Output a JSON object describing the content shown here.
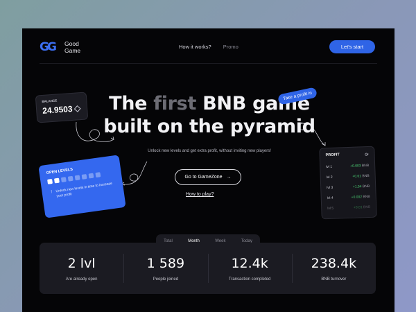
{
  "brand": {
    "line1": "Good",
    "line2": "Game",
    "mark": "GG",
    "accent": "#2f64e6"
  },
  "nav": {
    "items": [
      "How it works?",
      "Promo"
    ],
    "cta": "Let's start"
  },
  "hero": {
    "title_line1_a": "The ",
    "title_line1_b": "first",
    "title_line1_c": " BNB game",
    "title_line2": "built on the pyramid",
    "tag": "Take a profit in",
    "subtitle": "Unlock new levels and get extra profit, without inviting new players!",
    "primary_button": "Go to GameZone",
    "secondary_link": "How to play?"
  },
  "balance_card": {
    "label": "BALANCE",
    "value": "24.9503",
    "icon": "bnb-icon"
  },
  "levels_card": {
    "label": "OPEN LEVELS",
    "unlocked": 2,
    "total": 8,
    "note": "Unlock new levels in time to increase your profit"
  },
  "profit_card": {
    "title": "PROFIT",
    "rows": [
      {
        "level": "lvl 1",
        "value": "+0.003",
        "unit": "BNB"
      },
      {
        "level": "lvl 2",
        "value": "+0.01",
        "unit": "BNB"
      },
      {
        "level": "lvl 3",
        "value": "+1.54",
        "unit": "BNB"
      },
      {
        "level": "lvl 4",
        "value": "+0.002",
        "unit": "BNB"
      },
      {
        "level": "lvl 5",
        "value": "+0.01",
        "unit": "BNB"
      }
    ]
  },
  "stats": {
    "tabs": [
      "Total",
      "Month",
      "Week",
      "Today"
    ],
    "active_tab": "Month",
    "items": [
      {
        "value": "2 lvl",
        "caption": "Are already open"
      },
      {
        "value": "1 589",
        "caption": "People joined"
      },
      {
        "value": "12.4k",
        "caption": "Transaction completed"
      },
      {
        "value": "238.4k",
        "caption": "BNB turnover"
      }
    ]
  }
}
